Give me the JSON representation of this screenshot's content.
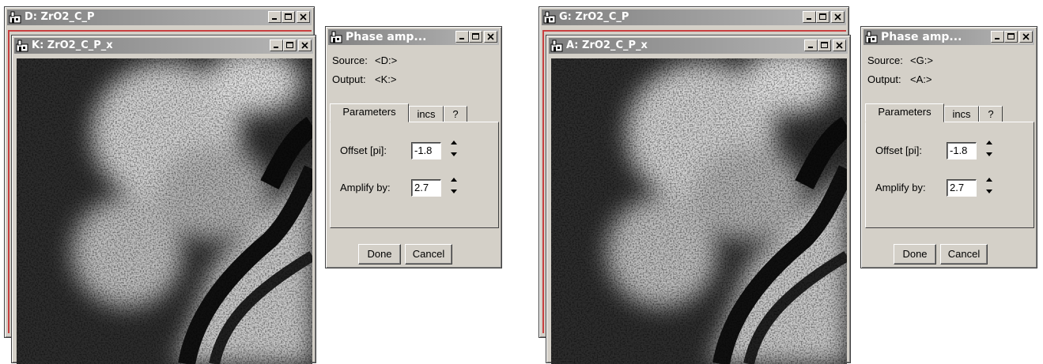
{
  "left": {
    "back_window": {
      "title": "D: ZrO2_C_P"
    },
    "front_window": {
      "title": "K: ZrO2_C_P_x"
    },
    "dialog": {
      "title": "Phase amp...",
      "source_label": "Source:",
      "source_value": "<D:>",
      "output_label": "Output:",
      "output_value": "<K:>",
      "tabs": [
        "Parameters",
        "incs",
        "?"
      ],
      "offset_label": "Offset [pi]:",
      "offset_value": "-1.8",
      "amplify_label": "Amplify by:",
      "amplify_value": "2.7",
      "done_label": "Done",
      "cancel_label": "Cancel"
    }
  },
  "right": {
    "back_window": {
      "title": "G: ZrO2_C_P"
    },
    "front_window": {
      "title": "A: ZrO2_C_P_x"
    },
    "dialog": {
      "title": "Phase amp...",
      "source_label": "Source:",
      "source_value": "<G:>",
      "output_label": "Output:",
      "output_value": "<A:>",
      "tabs": [
        "Parameters",
        "incs",
        "?"
      ],
      "offset_label": "Offset [pi]:",
      "offset_value": "-1.8",
      "amplify_label": "Amplify by:",
      "amplify_value": "2.7",
      "done_label": "Done",
      "cancel_label": "Cancel"
    }
  },
  "colors": {
    "window_face": "#d4d0c8",
    "title_inactive": "#808080",
    "border_red": "#c84040"
  }
}
